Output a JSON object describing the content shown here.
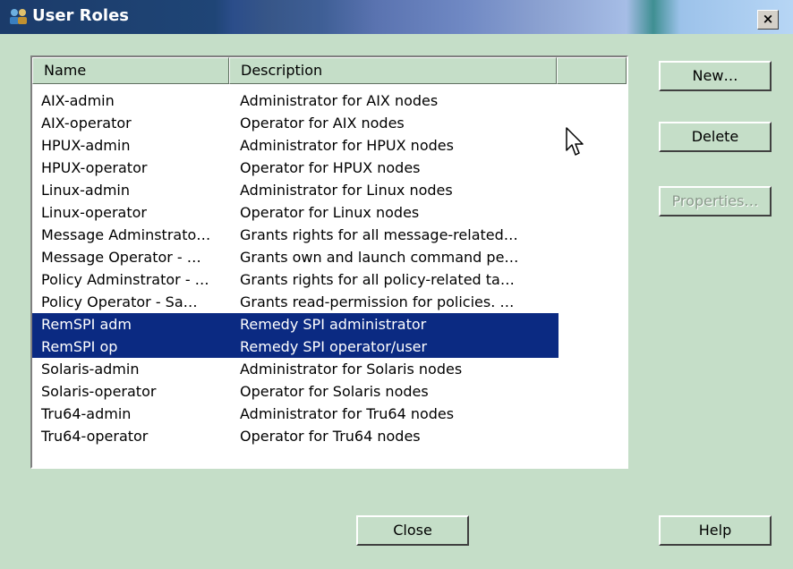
{
  "window": {
    "title": "User Roles",
    "close_glyph": "×",
    "app_icon": "user-roles-icon"
  },
  "list": {
    "columns": [
      "Name",
      "Description"
    ],
    "rows": [
      {
        "name": "AIX-admin",
        "description": "Administrator for AIX nodes",
        "selected": false
      },
      {
        "name": "AIX-operator",
        "description": "Operator for AIX nodes",
        "selected": false
      },
      {
        "name": "HPUX-admin",
        "description": "Administrator for HPUX nodes",
        "selected": false
      },
      {
        "name": "HPUX-operator",
        "description": "Operator for HPUX nodes",
        "selected": false
      },
      {
        "name": "Linux-admin",
        "description": "Administrator for Linux nodes",
        "selected": false
      },
      {
        "name": "Linux-operator",
        "description": "Operator for Linux nodes",
        "selected": false
      },
      {
        "name": "Message Adminstrato…",
        "description": "Grants rights for all message-related…",
        "selected": false
      },
      {
        "name": "Message Operator - …",
        "description": "Grants own and launch command pe…",
        "selected": false
      },
      {
        "name": "Policy Adminstrator - …",
        "description": "Grants rights for all policy-related ta…",
        "selected": false
      },
      {
        "name": "Policy Operator - Sa…",
        "description": "Grants read-permission for policies. …",
        "selected": false
      },
      {
        "name": "RemSPI adm",
        "description": "Remedy SPI administrator",
        "selected": true
      },
      {
        "name": "RemSPI op",
        "description": "Remedy SPI operator/user",
        "selected": true
      },
      {
        "name": "Solaris-admin",
        "description": "Administrator for Solaris nodes",
        "selected": false
      },
      {
        "name": "Solaris-operator",
        "description": "Operator for Solaris nodes",
        "selected": false
      },
      {
        "name": "Tru64-admin",
        "description": "Administrator for Tru64 nodes",
        "selected": false
      },
      {
        "name": "Tru64-operator",
        "description": "Operator for Tru64 nodes",
        "selected": false
      }
    ]
  },
  "buttons": {
    "new": "New…",
    "delete": "Delete",
    "properties": "Properties…",
    "close": "Close",
    "help": "Help"
  },
  "colors": {
    "dialog_bg": "#c5dec8",
    "selection": "#0b2a82",
    "title_start": "#1b3b6a",
    "title_end": "#b7d6f5"
  }
}
